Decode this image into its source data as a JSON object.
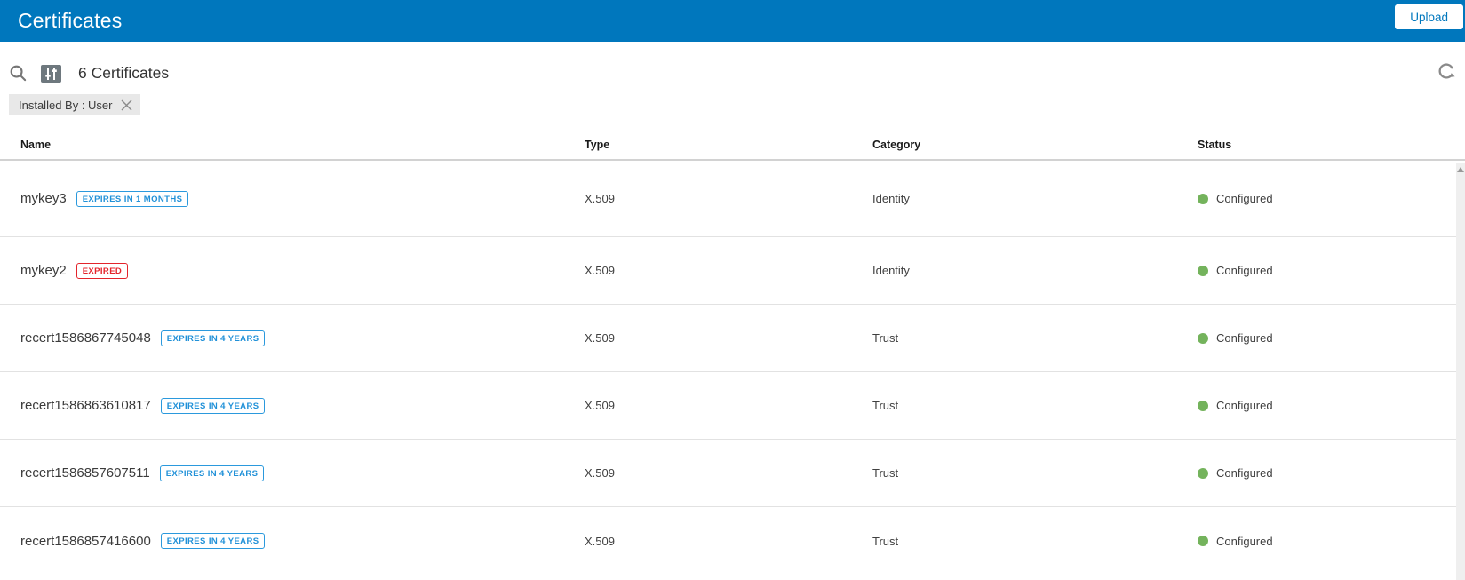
{
  "app": {
    "title": "Certificates"
  },
  "header": {
    "upload_button": "Upload"
  },
  "toolbar": {
    "count": "6 Certificates",
    "chip": "Installed By : User",
    "icons": [
      "search-icon",
      "filter-sliders-icon",
      "refresh-icon",
      "chip-close-x-icon"
    ]
  },
  "table": {
    "columns": [
      "Name",
      "Type",
      "Category",
      "Status"
    ],
    "rows": [
      {
        "name": "mykey3",
        "badge": {
          "label": "EXPIRES IN 1 MONTHS",
          "style": "info"
        },
        "type": "X.509",
        "category": "Identity",
        "status": "Configured"
      },
      {
        "name": "mykey2",
        "badge": {
          "label": "EXPIRED",
          "style": "danger"
        },
        "type": "X.509",
        "category": "Identity",
        "status": "Configured"
      },
      {
        "name": "recert1586867745048",
        "badge": {
          "label": "EXPIRES IN 4 YEARS",
          "style": "info"
        },
        "type": "X.509",
        "category": "Trust",
        "status": "Configured"
      },
      {
        "name": "recert1586863610817",
        "badge": {
          "label": "EXPIRES IN 4 YEARS",
          "style": "info"
        },
        "type": "X.509",
        "category": "Trust",
        "status": "Configured"
      },
      {
        "name": "recert1586857607511",
        "badge": {
          "label": "EXPIRES IN 4 YEARS",
          "style": "info"
        },
        "type": "X.509",
        "category": "Trust",
        "status": "Configured"
      },
      {
        "name": "recert1586857416600",
        "badge": {
          "label": "EXPIRES IN 4 YEARS",
          "style": "info"
        },
        "type": "X.509",
        "category": "Trust",
        "status": "Configured"
      }
    ]
  },
  "colors": {
    "header_bg": "#0077bd",
    "upload_text": "#0077bd",
    "badge_info": "#2191d8",
    "badge_danger": "#e3242b",
    "status_configured_dot": "#74b35c",
    "chip_bg": "#e8e8e8",
    "row_divider": "#e2e2e2"
  }
}
